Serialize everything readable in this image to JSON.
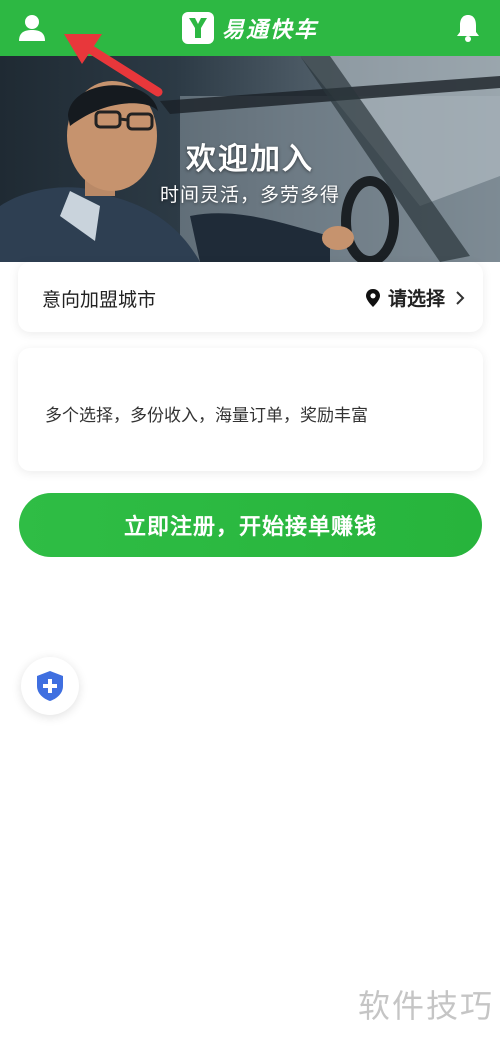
{
  "header": {
    "brand_name": "易通快车",
    "user_icon": "user-icon",
    "bell_icon": "bell-icon",
    "color": "#2db843"
  },
  "hero": {
    "title": "欢迎加入",
    "subtitle": "时间灵活，多劳多得"
  },
  "city": {
    "label": "意向加盟城市",
    "select_label": "请选择",
    "pin_icon": "location-pin-icon",
    "chevron_icon": "chevron-right-icon"
  },
  "info": {
    "text": "多个选择，多份收入，海量订单，奖励丰富"
  },
  "cta": {
    "label": "立即注册，开始接单赚钱",
    "color": "#2db843"
  },
  "float": {
    "icon": "shield-plus-icon"
  },
  "watermark": {
    "text": "软件技巧"
  },
  "annotation": {
    "arrow_color": "#e8373b"
  }
}
